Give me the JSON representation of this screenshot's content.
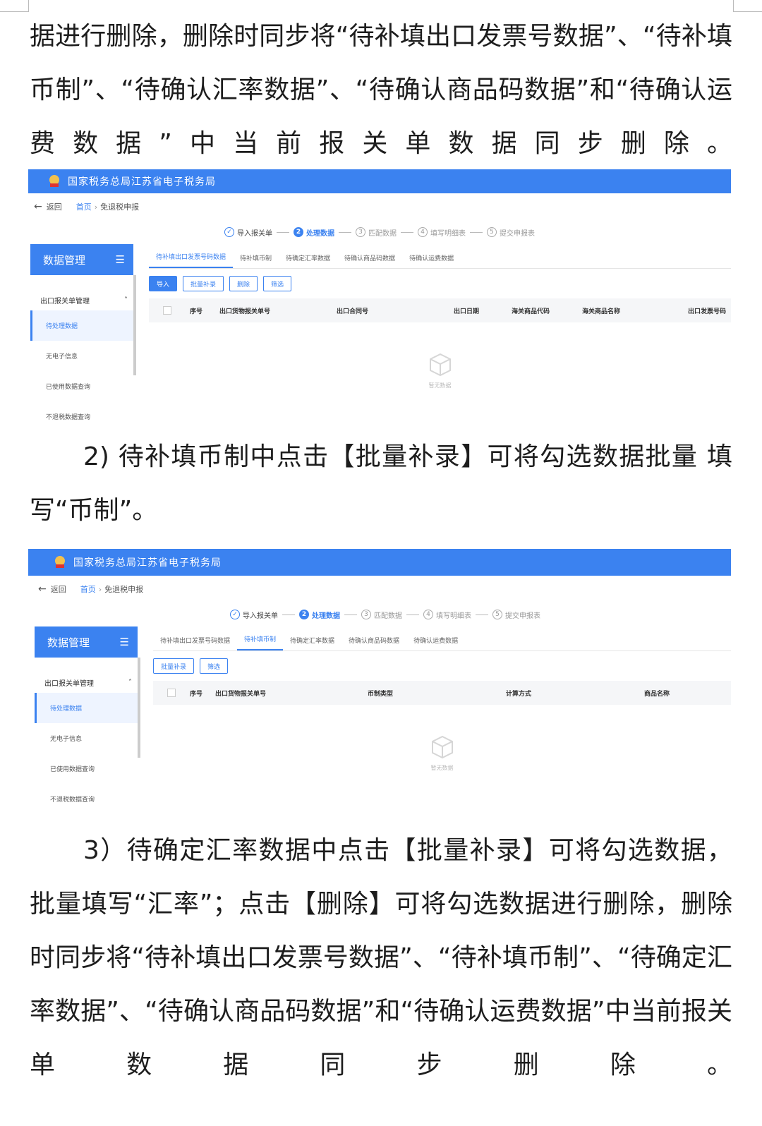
{
  "top_text": "据进行删除，删除时同步将“待补填出口发票号数据”、“待补填币制”、“待确认汇率数据”、“待确认商品码数据”和“待确认运费数据”中当前报关单数据同步删除。",
  "para2_line1": "2) 待补填币制中点击【批量补录】可将勾选数据批量 填",
  "para2_line2": "写“币制”。",
  "para3": "3）待确定汇率数据中点击【批量补录】可将勾选数据，批量填写“汇率”；点击【删除】可将勾选数据进行删除，删除时同步将“待补填出口发票号数据”、“待补填币制”、“待确定汇率数据”、“待确认商品码数据”和“待确认运费数据”中当前报关单数据同步删除。",
  "common": {
    "app_title": "国家税务总局江苏省电子税务局",
    "back": "返回",
    "crumb_home": "首页",
    "crumb_sep": "›",
    "crumb_current": "免退税申报",
    "steps": [
      "导入报关单",
      "处理数据",
      "匹配数据",
      "填写明细表",
      "提交申报表"
    ],
    "step_nums": [
      "✓",
      "2",
      "3",
      "4",
      "5"
    ],
    "sidebar_title": "数据管理",
    "sidebar_group": "出口报关单管理",
    "sidebar_items": [
      "待处理数据",
      "无电子信息",
      "已使用数据查询",
      "不退税数据查询"
    ],
    "empty_text": "暂无数据"
  },
  "shot1": {
    "tabs": [
      "待补填出口发票号码数据",
      "待补填币制",
      "待确定汇率数据",
      "待确认商品码数据",
      "待确认运费数据"
    ],
    "buttons": [
      "导入",
      "批量补录",
      "删除",
      "筛选"
    ],
    "columns": [
      "序号",
      "出口货物报关单号",
      "出口合同号",
      "出口日期",
      "海关商品代码",
      "海关商品名称",
      "出口发票号码"
    ]
  },
  "shot2": {
    "tabs": [
      "待补填出口发票号码数据",
      "待补填币制",
      "待确定汇率数据",
      "待确认商品码数据",
      "待确认运费数据"
    ],
    "buttons": [
      "批量补录",
      "筛选"
    ],
    "columns": [
      "序号",
      "出口货物报关单号",
      "币制类型",
      "计算方式",
      "商品名称"
    ]
  }
}
